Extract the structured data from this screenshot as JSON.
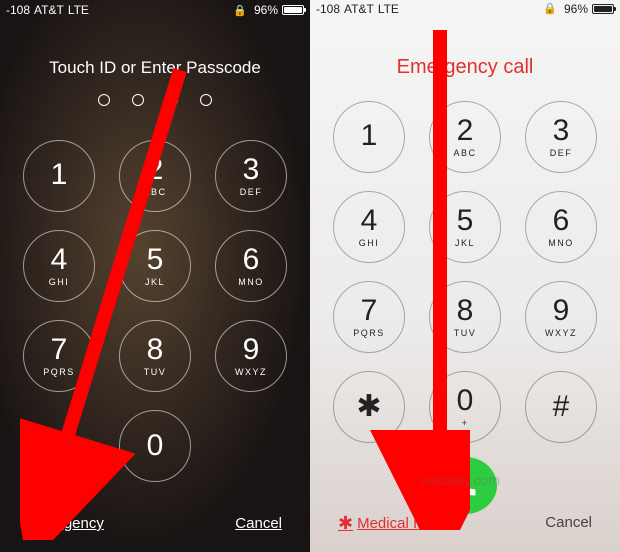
{
  "status": {
    "signal": "-108",
    "carrier": "AT&T",
    "network": "LTE",
    "battery": "96%"
  },
  "left": {
    "title": "Touch ID or Enter Passcode",
    "keys": [
      {
        "d": "1",
        "l": ""
      },
      {
        "d": "2",
        "l": "ABC"
      },
      {
        "d": "3",
        "l": "DEF"
      },
      {
        "d": "4",
        "l": "GHI"
      },
      {
        "d": "5",
        "l": "JKL"
      },
      {
        "d": "6",
        "l": "MNO"
      },
      {
        "d": "7",
        "l": "PQRS"
      },
      {
        "d": "8",
        "l": "TUV"
      },
      {
        "d": "9",
        "l": "WXYZ"
      }
    ],
    "zero": {
      "d": "0",
      "l": ""
    },
    "emergency": "Emergency",
    "cancel": "Cancel"
  },
  "right": {
    "title": "Emergency call",
    "keys": [
      {
        "d": "1",
        "l": ""
      },
      {
        "d": "2",
        "l": "ABC"
      },
      {
        "d": "3",
        "l": "DEF"
      },
      {
        "d": "4",
        "l": "GHI"
      },
      {
        "d": "5",
        "l": "JKL"
      },
      {
        "d": "6",
        "l": "MNO"
      },
      {
        "d": "7",
        "l": "PQRS"
      },
      {
        "d": "8",
        "l": "TUV"
      },
      {
        "d": "9",
        "l": "WXYZ"
      }
    ],
    "star": "✱",
    "zero": {
      "d": "0",
      "l": "+"
    },
    "hash": "#",
    "medical": "Medical ID",
    "cancel": "Cancel"
  },
  "watermark": "osxdaily.com"
}
